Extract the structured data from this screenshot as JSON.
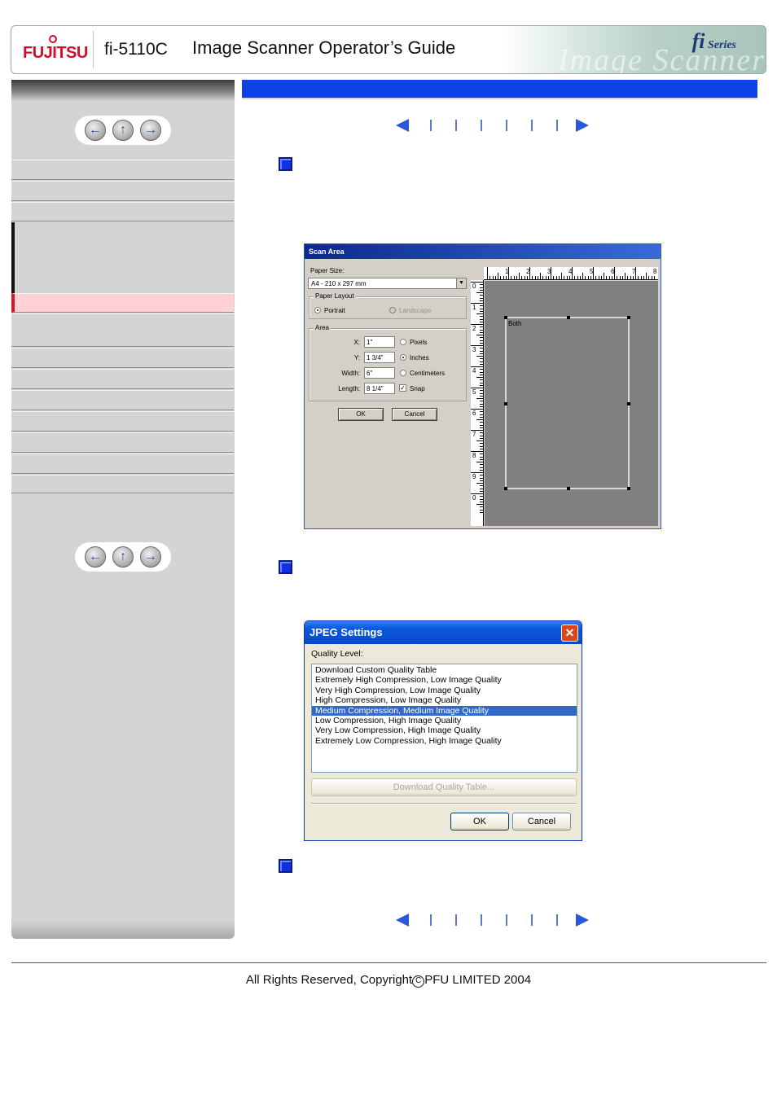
{
  "header": {
    "brand": "FUJITSU",
    "model": "fi-5110C",
    "title": "Image Scanner Operator’s Guide",
    "series_prefix": "fi",
    "series_label": "Series",
    "decor_text": "Image Scanner"
  },
  "sidebar": {
    "nav_top": {
      "back": "←",
      "up": "↑",
      "forward": "→"
    },
    "nav_bottom": {
      "back": "←",
      "up": "↑",
      "forward": "→"
    },
    "active_item_color": "#ffd0d4"
  },
  "main": {
    "title_bar_color": "#0d42e8",
    "page_nav": {
      "prev_icon": "triangle-left-icon",
      "next_icon": "triangle-right-icon",
      "separators": 6
    }
  },
  "scan_area_dialog": {
    "title": "Scan Area",
    "paper_size_label": "Paper Size:",
    "paper_size_value": "A4 - 210 x 297 mm",
    "paper_layout_label": "Paper Layout",
    "portrait_label": "Portrait",
    "landscape_label": "Landscape",
    "area_label": "Area",
    "x_label": "X:",
    "x_value": "1\"",
    "y_label": "Y:",
    "y_value": "1 3/4\"",
    "width_label": "Width:",
    "width_value": "6\"",
    "length_label": "Length:",
    "length_value": "8 1/4\"",
    "unit_pixels": "Pixels",
    "unit_inches": "Inches",
    "unit_centimeters": "Centimeters",
    "snap_label": "Snap",
    "snap_checked": "✓",
    "ok_label": "OK",
    "cancel_label": "Cancel",
    "canvas_label": "Both",
    "ruler_top": [
      "1",
      "2",
      "3",
      "4",
      "5",
      "6",
      "7",
      "8"
    ],
    "ruler_left": [
      "0",
      "1",
      "2",
      "3",
      "4",
      "5",
      "6",
      "7",
      "8",
      "9",
      "0"
    ]
  },
  "jpeg_dialog": {
    "title": "JPEG Settings",
    "close_label": "✕",
    "quality_label": "Quality Level:",
    "options": [
      "Download Custom Quality Table",
      "Extremely High Compression, Low Image Quality",
      "Very High Compression, Low Image Quality",
      "High Compression, Low Image Quality",
      "Medium Compression, Medium Image Quality",
      "Low Compression, High Image Quality",
      "Very Low Compression, High Image Quality",
      "Extremely Low Compression, High Image Quality"
    ],
    "selected_index": 4,
    "download_button": "Download Quality Table...",
    "ok_label": "OK",
    "cancel_label": "Cancel"
  },
  "footer": {
    "copyright_prefix": "All Rights Reserved,  Copyright",
    "copyright_symbol": "C",
    "copyright_suffix": "PFU LIMITED 2004"
  }
}
